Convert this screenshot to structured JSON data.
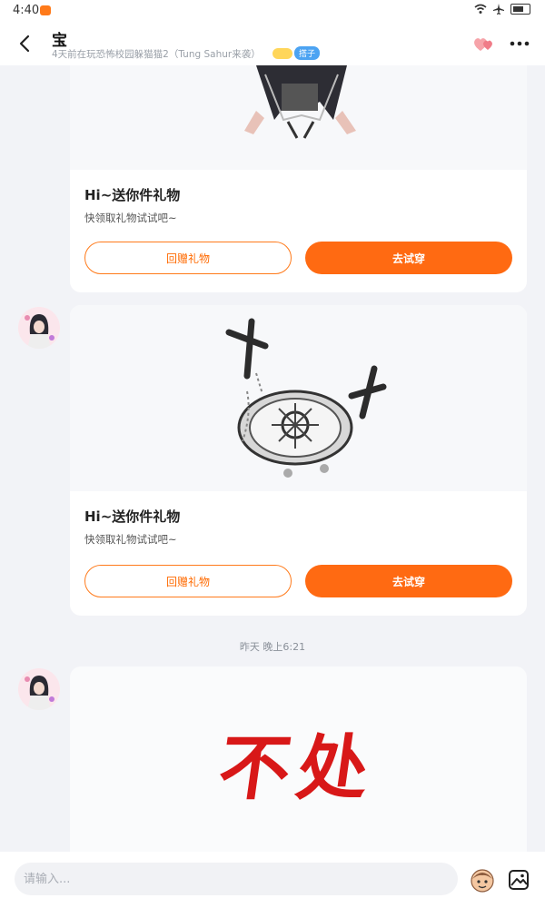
{
  "status_bar": {
    "time": "4:40"
  },
  "header": {
    "title": "宝",
    "subtitle": "4天前在玩恐怖校园躲猫猫2（Tung Sahur来袭）",
    "badge": "搭子"
  },
  "messages": [
    {
      "gift_title": "Hi~送你件礼物",
      "gift_desc": "快领取礼物试试吧~",
      "return_label": "回赠礼物",
      "try_label": "去试穿"
    },
    {
      "gift_title": "Hi~送你件礼物",
      "gift_desc": "快领取礼物试试吧~",
      "return_label": "回赠礼物",
      "try_label": "去试穿"
    }
  ],
  "timestamp": "昨天 晚上6:21",
  "sticker_text": "不处",
  "input": {
    "placeholder": "请输入..."
  },
  "colors": {
    "accent": "#ff6a12",
    "background": "#f2f3f7"
  }
}
